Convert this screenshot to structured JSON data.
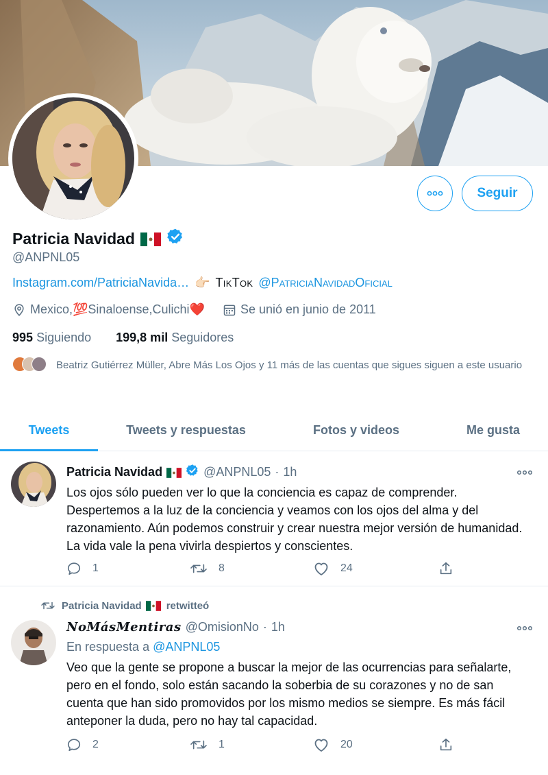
{
  "profile": {
    "name": "Patricia Navidad",
    "flag_emoji": "mexico-flag",
    "verified": true,
    "handle": "@ANPNL05",
    "bio_link": "Instagram.com/PatriciaNavida…",
    "bio_pointer": "👉🏻",
    "bio_tiktok_label": "TikTok",
    "bio_tiktok_handle": "@PatriciaNavidadOficial",
    "location": "Mexico,💯Sinaloense,Culichi❤️",
    "joined": "Se unió en junio de 2011",
    "following_count": "995",
    "following_label": "Siguiendo",
    "followers_count": "199,8 mil",
    "followers_label": "Seguidores",
    "known_followers": "Beatriz Gutiérrez Müller, Abre Más Los Ojos y 11 más de las cuentas que sigues siguen a este usuario"
  },
  "actions": {
    "follow_label": "Seguir",
    "more_icon": "more-horizontal-icon"
  },
  "tabs": [
    {
      "label": "Tweets",
      "active": true
    },
    {
      "label": "Tweets y respuestas",
      "active": false
    },
    {
      "label": "Fotos y videos",
      "active": false
    },
    {
      "label": "Me gusta",
      "active": false
    }
  ],
  "tweets": [
    {
      "author": "Patricia Navidad",
      "handle": "@ANPNL05",
      "separator": "·",
      "time": "1h",
      "text": "Los ojos sólo pueden ver lo que la conciencia es capaz de comprender. Despertemos a la luz de la conciencia y veamos con los ojos del alma y del razonamiento. Aún podemos construir y crear nuestra mejor versión de humanidad. La vida vale la pena vivirla despiertos y conscientes.",
      "replies": "1",
      "retweets": "8",
      "likes": "24"
    },
    {
      "retweeted_by": "Patricia Navidad",
      "retweet_label": "retwitteó",
      "author": "𝑵𝒐𝑴á𝒔𝑴𝒆𝒏𝒕𝒊𝒓𝒂𝒔",
      "handle": "@OmisionNo",
      "separator": "·",
      "time": "1h",
      "reply_prefix": "En respuesta a",
      "reply_to": "@ANPNL05",
      "text": "Veo que la gente se propone a buscar la mejor de las ocurrencias para señalarte, pero en el fondo, solo están sacando la soberbia de su corazones y no de san cuenta que han sido promovidos por los mismo medios se siempre. Es más fácil anteponer la duda, pero no hay tal capacidad.",
      "replies": "2",
      "retweets": "1",
      "likes": "20"
    }
  ],
  "colors": {
    "accent": "#1da1f2",
    "link": "#1b95e0",
    "secondary_text": "#5b7083",
    "like_heart": "#e0245e"
  }
}
